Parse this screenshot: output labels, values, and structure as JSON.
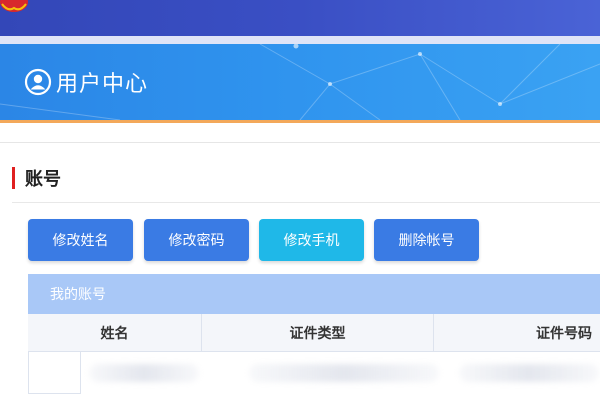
{
  "banner": {
    "title": "用户中心",
    "icon": "user-circle-icon"
  },
  "section": {
    "title": "账号",
    "accent_color": "#e02020"
  },
  "actions": [
    {
      "label": "修改姓名",
      "style": "blue"
    },
    {
      "label": "修改密码",
      "style": "blue"
    },
    {
      "label": "修改手机",
      "style": "cyan"
    },
    {
      "label": "删除帐号",
      "style": "blue"
    }
  ],
  "account_panel": {
    "title": "我的账号",
    "columns": [
      "姓名",
      "证件类型",
      "证件号码"
    ]
  },
  "colors": {
    "topbar": "#3347b8",
    "banner": "#2f93ee",
    "button_blue": "#3a7be4",
    "button_cyan": "#1fb8e8",
    "panel_header": "#a9c8f7"
  }
}
